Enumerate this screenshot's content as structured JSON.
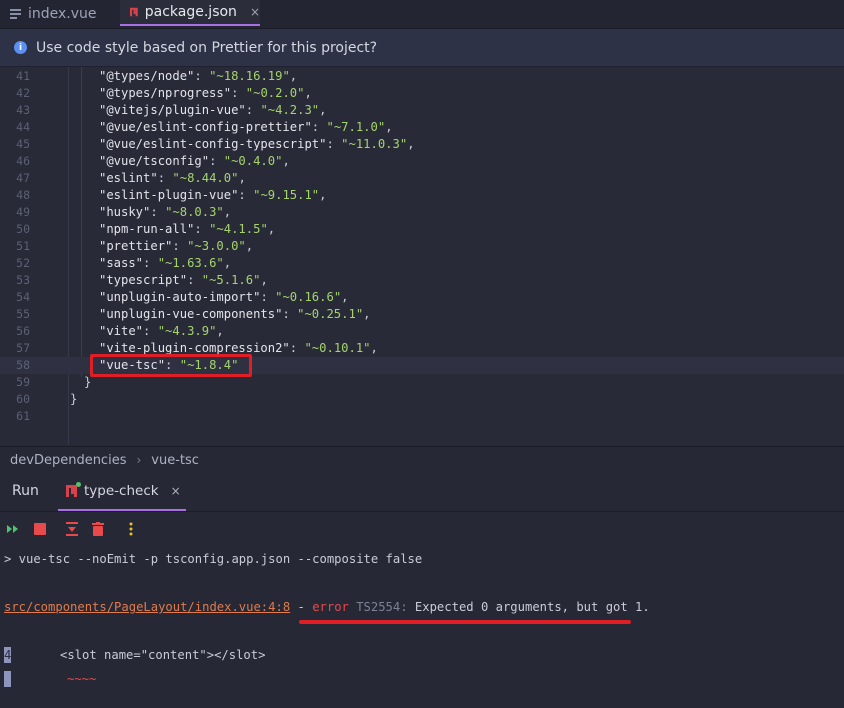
{
  "tabs": [
    {
      "label": "index.vue",
      "active": false,
      "icon": "list-file-icon"
    },
    {
      "label": "package.json",
      "active": true,
      "icon": "npm-icon"
    }
  ],
  "tab_close_glyph": "×",
  "banner": {
    "text": "Use code style based on Prettier for this project?",
    "icon": "info-icon"
  },
  "editor_lines": [
    {
      "n": "41",
      "key": "\"@types/node\"",
      "val": "\"~18.16.19\"",
      "comma": ","
    },
    {
      "n": "42",
      "key": "\"@types/nprogress\"",
      "val": "\"~0.2.0\"",
      "comma": ","
    },
    {
      "n": "43",
      "key": "\"@vitejs/plugin-vue\"",
      "val": "\"~4.2.3\"",
      "comma": ","
    },
    {
      "n": "44",
      "key": "\"@vue/eslint-config-prettier\"",
      "val": "\"~7.1.0\"",
      "comma": ","
    },
    {
      "n": "45",
      "key": "\"@vue/eslint-config-typescript\"",
      "val": "\"~11.0.3\"",
      "comma": ","
    },
    {
      "n": "46",
      "key": "\"@vue/tsconfig\"",
      "val": "\"~0.4.0\"",
      "comma": ","
    },
    {
      "n": "47",
      "key": "\"eslint\"",
      "val": "\"~8.44.0\"",
      "comma": ","
    },
    {
      "n": "48",
      "key": "\"eslint-plugin-vue\"",
      "val": "\"~9.15.1\"",
      "comma": ","
    },
    {
      "n": "49",
      "key": "\"husky\"",
      "val": "\"~8.0.3\"",
      "comma": ","
    },
    {
      "n": "50",
      "key": "\"npm-run-all\"",
      "val": "\"~4.1.5\"",
      "comma": ","
    },
    {
      "n": "51",
      "key": "\"prettier\"",
      "val": "\"~3.0.0\"",
      "comma": ","
    },
    {
      "n": "52",
      "key": "\"sass\"",
      "val": "\"~1.63.6\"",
      "comma": ","
    },
    {
      "n": "53",
      "key": "\"typescript\"",
      "val": "\"~5.1.6\"",
      "comma": ","
    },
    {
      "n": "54",
      "key": "\"unplugin-auto-import\"",
      "val": "\"~0.16.6\"",
      "comma": ","
    },
    {
      "n": "55",
      "key": "\"unplugin-vue-components\"",
      "val": "\"~0.25.1\"",
      "comma": ","
    },
    {
      "n": "56",
      "key": "\"vite\"",
      "val": "\"~4.3.9\"",
      "comma": ","
    },
    {
      "n": "57",
      "key": "\"vite-plugin-compression2\"",
      "val": "\"~0.10.1\"",
      "comma": ","
    },
    {
      "n": "58",
      "key": "\"vue-tsc\"",
      "val": "\"~1.8.4\"",
      "comma": ""
    }
  ],
  "closing_lines": [
    {
      "n": "59",
      "text": "}"
    },
    {
      "n": "60",
      "text": "}"
    },
    {
      "n": "61",
      "text": ""
    }
  ],
  "breadcrumb": [
    "devDependencies",
    "vue-tsc"
  ],
  "breadcrumb_sep": "›",
  "run": {
    "label": "Run",
    "tab_label": "type-check",
    "command": "> vue-tsc --noEmit -p tsconfig.app.json --composite false",
    "error_path": "src/components/PageLayout/index.vue:4:8",
    "error_dash": " - ",
    "error_word": "error",
    "error_code": " TS2554:",
    "error_msg": " Expected 0 arguments, but got 1.",
    "line_number": "4",
    "source_line": "<slot name=\"content\"></slot>",
    "squiggle": "~~~~"
  },
  "colors": {
    "accent": "#a970e6",
    "error": "#e8494a",
    "highlight_box": "#e01e25",
    "string": "#a5d46c",
    "path": "#e07b4b"
  }
}
